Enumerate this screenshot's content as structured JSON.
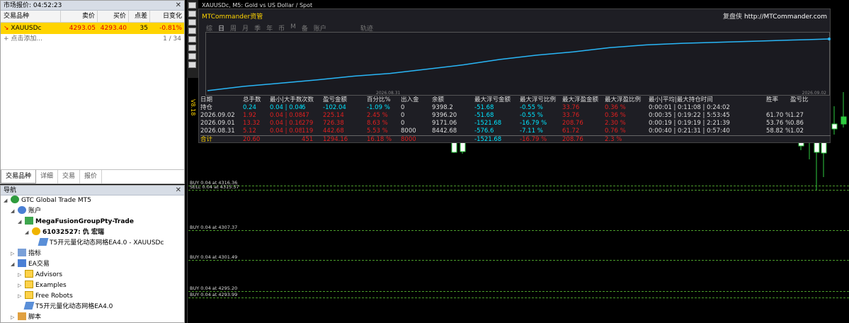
{
  "market_watch": {
    "title": "市场报价: 04:52:23",
    "columns": [
      "交易品种",
      "卖价",
      "买价",
      "点差",
      "日变化"
    ],
    "row": {
      "symbol": "XAUUSDc",
      "bid": "4293.05",
      "ask": "4293.40",
      "spread": "35",
      "change": "-0.81%"
    },
    "add_label": "点击添加...",
    "count": "1 / 34",
    "tabs": [
      "交易品种",
      "详细",
      "交易",
      "报价"
    ]
  },
  "navigator": {
    "title": "导航",
    "items": [
      {
        "label": "GTC Global Trade MT5",
        "icon": "mt5-logo-icon",
        "indent": 0
      },
      {
        "label": "账户",
        "icon": "accounts-icon",
        "indent": 1
      },
      {
        "label": "MegaFusionGroupPty-Trade",
        "icon": "server-icon",
        "indent": 2,
        "bold": true
      },
      {
        "label": "61032527: 仇 宏瑞",
        "icon": "user-icon",
        "indent": 3,
        "bold": true
      },
      {
        "label": "T5开元量化动态网格EA4.0 - XAUUSDc",
        "icon": "ea-icon",
        "indent": 4
      },
      {
        "label": "指标",
        "icon": "indicators-icon",
        "indent": 1
      },
      {
        "label": "EA交易",
        "icon": "expert-icon",
        "indent": 1
      },
      {
        "label": "Advisors",
        "icon": "folder-icon",
        "indent": 2
      },
      {
        "label": "Examples",
        "icon": "folder-icon",
        "indent": 2
      },
      {
        "label": "Free Robots",
        "icon": "folder-icon",
        "indent": 2
      },
      {
        "label": "T5开元量化动态网格EA4.0",
        "icon": "ea-icon",
        "indent": 2
      },
      {
        "label": "脚本",
        "icon": "script-icon",
        "indent": 1
      }
    ]
  },
  "chart": {
    "title": "XAUUSDc, M5:  Gold vs US Dollar / Spot",
    "version": "V8.18",
    "lines": [
      {
        "label": "BUY 0.04 at 4316.36",
        "price": 4316.36
      },
      {
        "label": "SELL 0.04 at 4315.57",
        "price": 4315.57
      },
      {
        "label": "BUY 0.04 at 4307.37",
        "price": 4307.37
      },
      {
        "label": "BUY 0.04 at 4301.49",
        "price": 4301.49
      },
      {
        "label": "BUY 0.04 at 4295.20",
        "price": 4295.2
      },
      {
        "label": "BUY 0.04 at 4293.99",
        "price": 4293.99
      }
    ]
  },
  "panel": {
    "brand": "MTCommander资管",
    "right_label": "复盘侠",
    "right_url": "http://MTCommander.com",
    "nav": [
      "综",
      "日",
      "周",
      "月",
      "季",
      "年",
      "币",
      "M",
      "备",
      "账户",
      "轨迹"
    ],
    "nav_active": "日",
    "date_start": "2026.08.31",
    "date_end": "2026.09.02",
    "equity_curve": [
      0.0,
      0.08,
      0.14,
      0.2,
      0.27,
      0.32,
      0.4,
      0.48,
      0.58,
      0.66,
      0.72,
      0.8,
      0.85,
      0.88,
      0.9,
      0.92,
      0.94,
      0.96
    ],
    "headers": [
      "日期",
      "总手数",
      "最小|大手数",
      "次数",
      "盈亏金额",
      "百分比%",
      "出入金",
      "余额",
      "最大浮亏金额",
      "最大浮亏比例",
      "最大浮盈金额",
      "最大浮盈比例",
      "最小|平均|最大持仓时间",
      "胜率",
      "盈亏比"
    ],
    "rows": [
      {
        "label": "持仓",
        "cells": [
          "0.24",
          "0.04 | 0.04",
          "6",
          "-102.04",
          "-1.09 %",
          "0",
          "9398.2",
          "-51.68",
          "-0.55 %",
          "33.76",
          "0.36 %",
          "0:00:01 | 0:11:08 | 0:24:02",
          "",
          ""
        ]
      },
      {
        "label": "2026.09.02",
        "cells": [
          "1.92",
          "0.04 | 0.08",
          "47",
          "225.14",
          "2.45 %",
          "0",
          "9396.20",
          "-51.68",
          "-0.55 %",
          "33.76",
          "0.36 %",
          "0:00:35 | 0:19:22 | 5:53:45",
          "61.70 %",
          "1.27"
        ]
      },
      {
        "label": "2026.09.01",
        "cells": [
          "13.32",
          "0.04 | 0.16",
          "279",
          "726.38",
          "8.63 %",
          "0",
          "9171.06",
          "-1521.68",
          "-16.79 %",
          "208.76",
          "2.30 %",
          "0:00:19 | 0:19:19 | 2:21:39",
          "53.76 %",
          "0.86"
        ]
      },
      {
        "label": "2026.08.31",
        "cells": [
          "5.12",
          "0.04 | 0.08",
          "119",
          "442.68",
          "5.53 %",
          "8000",
          "8442.68",
          "-576.6",
          "-7.11 %",
          "61.72",
          "0.76 %",
          "0:00:40 | 0:21:31 | 0:57:40",
          "58.82 %",
          "1.02"
        ]
      }
    ],
    "total": {
      "label": "合计",
      "cells": [
        "20.60",
        "",
        "451",
        "1294.16",
        "16.18 %",
        "8000",
        "",
        "-1521.68",
        "-16.79 %",
        "208.76",
        "2.3 %",
        "",
        "",
        ""
      ]
    }
  }
}
